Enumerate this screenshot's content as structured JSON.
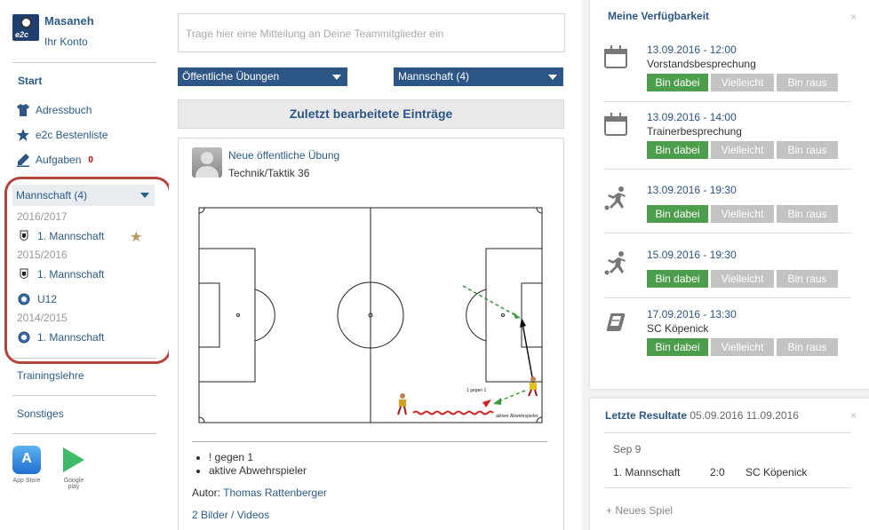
{
  "user": {
    "name": "Masaneh",
    "account_link": "Ihr Konto",
    "logo_text": "e2c"
  },
  "nav": {
    "start": "Start",
    "address_book": "Adressbuch",
    "leaderboard": "e2c Bestenliste",
    "tasks": "Aufgaben",
    "tasks_count": "0"
  },
  "team_selector": {
    "selected": "Mannschaft (4)",
    "seasons": [
      {
        "label": "2016/2017",
        "teams": [
          "1. Mannschaft"
        ]
      },
      {
        "label": "2015/2016",
        "teams": [
          "1. Mannschaft",
          "U12"
        ]
      },
      {
        "label": "2014/2015",
        "teams": [
          "1. Mannschaft"
        ]
      }
    ]
  },
  "side_links": {
    "training": "Trainingslehre",
    "misc": "Sonstiges"
  },
  "stores": {
    "app_store": "App Store",
    "google_play": "Google play"
  },
  "composer": {
    "placeholder": "Trage hier eine Mitteilung an Deine Teammitglieder ein"
  },
  "filters": {
    "exercises": "Öffentliche Übungen",
    "team": "Mannschaft (4)"
  },
  "recent_header": "Zuletzt bearbeitete Einträge",
  "post": {
    "title": "Neue öffentliche Übung",
    "subtitle": "Technik/Taktik 36",
    "diagram_label_1": "1 gegen 1",
    "diagram_label_2": "aktiver Abwehrspieler",
    "bullets": [
      "! gegen 1",
      "aktive Abwehrspieler"
    ],
    "author_label": "Autor:",
    "author_name": "Thomas Rattenberger",
    "media_link": "2 Bilder / Videos"
  },
  "availability": {
    "title": "Meine Verfügbarkeit",
    "close": "×",
    "buttons": {
      "yes": "Bin dabei",
      "maybe": "Vielleicht",
      "no": "Bin raus"
    },
    "events": [
      {
        "date": "13.09.2016 - 12:00",
        "title": "Vorstandsbesprechung",
        "icon": "calendar-icon"
      },
      {
        "date": "13.09.2016 - 14:00",
        "title": "Trainerbesprechung",
        "icon": "calendar-icon"
      },
      {
        "date": "13.09.2016 - 19:30",
        "title": "",
        "icon": "training-icon"
      },
      {
        "date": "15.09.2016 - 19:30",
        "title": "",
        "icon": "training-icon"
      },
      {
        "date": "17.09.2016 - 13:30",
        "title": "SC Köpenick",
        "icon": "match-icon"
      }
    ]
  },
  "results": {
    "title": "Letzte Resultate",
    "range": "05.09.2016 11.09.2016",
    "close": "×",
    "date": "Sep 9",
    "home": "1. Mannschaft",
    "score": "2:0",
    "away": "SC Köpenick",
    "add_game": "+ Neues Spiel"
  },
  "colors": {
    "brand": "#2b5686",
    "accept": "#4c9e4c",
    "neutral": "#c3c3c3",
    "highlight": "#b5453c"
  }
}
